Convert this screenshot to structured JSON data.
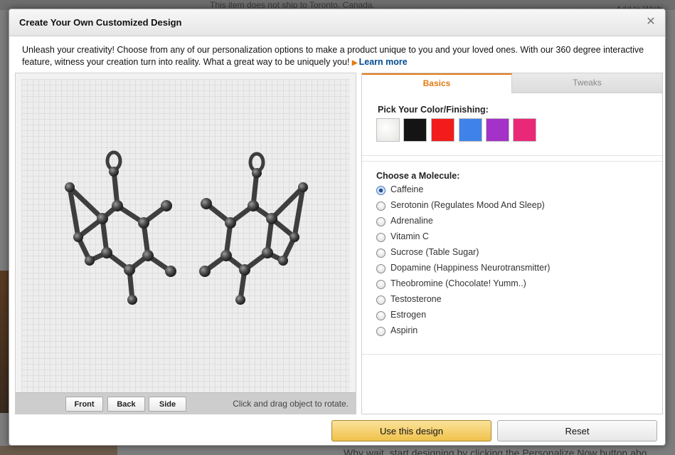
{
  "background": {
    "top_text": "This item does not ship to Toronto, Canada.",
    "top_right_text": "Add to Wish",
    "bottom_text": "Why wait, start designing by clicking the Personalize Now button abo"
  },
  "dialog": {
    "title": "Create Your Own Customized Design",
    "close_glyph": "✕",
    "intro_text": "Unleash your creativity! Choose from any of our personalization options to make a product unique to you and your loved ones. With our 360 degree interactive feature, witness your creation turn into reality. What a great way to be uniquely you! ",
    "learn_more": "Learn more"
  },
  "viewer": {
    "buttons": {
      "front": "Front",
      "back": "Back",
      "side": "Side"
    },
    "hint": "Click and drag object to rotate."
  },
  "panel": {
    "tabs": {
      "basics": "Basics",
      "tweaks": "Tweaks"
    },
    "color_heading": "Pick Your Color/Finishing:",
    "colors": [
      "#f4f4f2",
      "#141414",
      "#f21c1c",
      "#3f82ea",
      "#a431c8",
      "#ea2878"
    ],
    "molecule_heading": "Choose a Molecule:",
    "selected_molecule": "Caffeine",
    "molecules": [
      "Caffeine",
      "Serotonin (Regulates Mood And Sleep)",
      "Adrenaline",
      "Vitamin C",
      "Sucrose (Table Sugar)",
      "Dopamine (Happiness Neurotransmitter)",
      "Theobromine (Chocolate! Yumm..)",
      "Testosterone",
      "Estrogen",
      "Aspirin"
    ]
  },
  "footer": {
    "use_design": "Use this design",
    "reset": "Reset"
  }
}
